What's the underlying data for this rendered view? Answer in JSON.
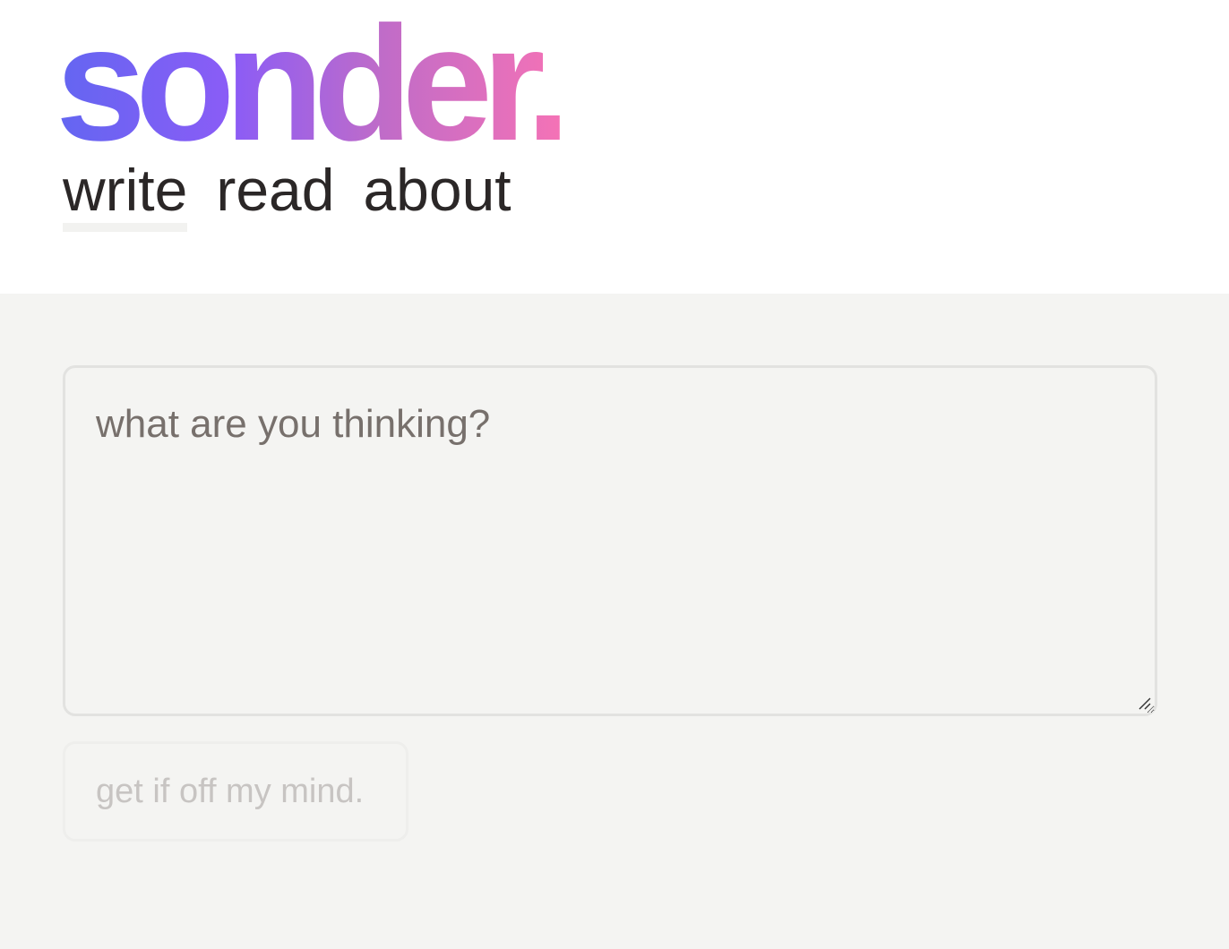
{
  "header": {
    "logo_text": "sonder.",
    "nav": [
      {
        "label": "write",
        "active": true
      },
      {
        "label": "read",
        "active": false
      },
      {
        "label": "about",
        "active": false
      }
    ]
  },
  "composer": {
    "placeholder": "what are you thinking?",
    "value": "",
    "submit_label": "get if off my mind.",
    "submit_disabled": true
  },
  "colors": {
    "logo_gradient": [
      "#6366f1",
      "#8b5cf6",
      "#c06cc8",
      "#f472b6"
    ],
    "text": "#2b2727",
    "placeholder": "#77706c",
    "page_background": "#f4f4f2",
    "header_background": "#ffffff"
  },
  "icons": {
    "resize_grip": "resize-grip-icon"
  }
}
